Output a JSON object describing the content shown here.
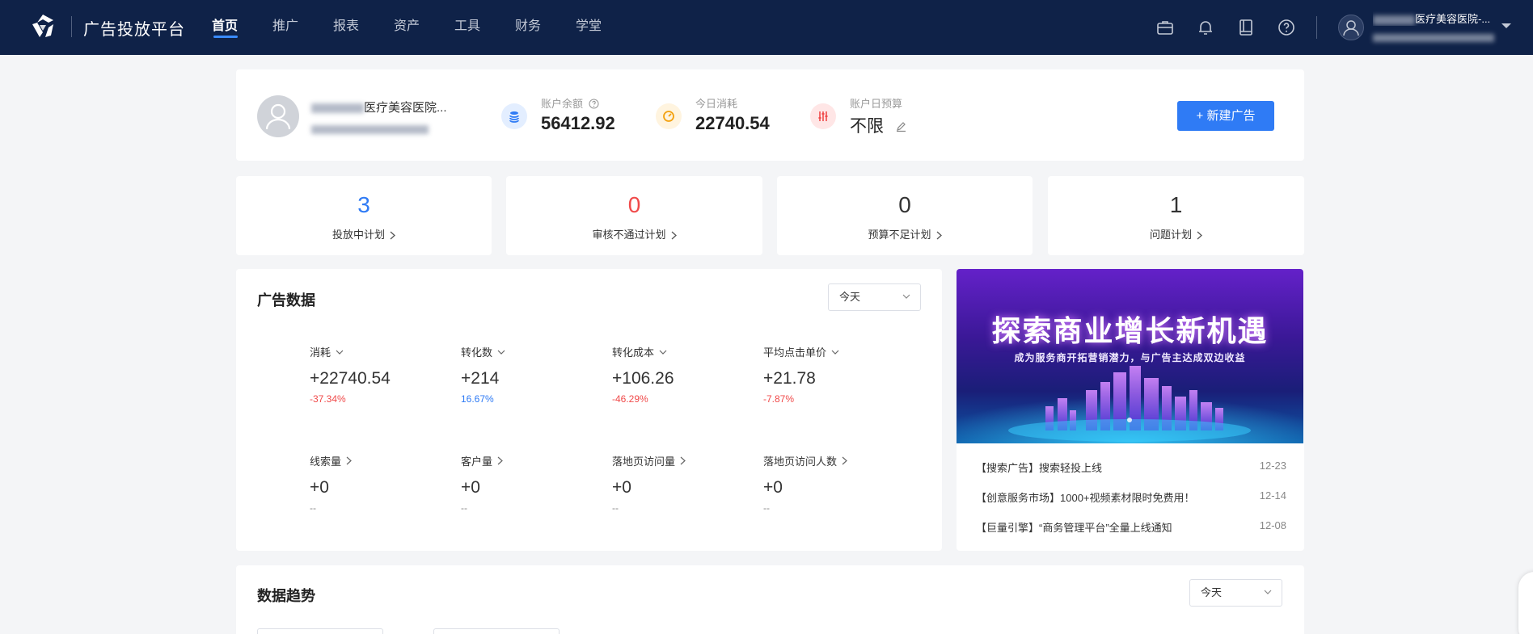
{
  "topbar": {
    "brand": "广告投放平台",
    "nav": [
      {
        "label": "首页",
        "active": true
      },
      {
        "label": "推广",
        "active": false
      },
      {
        "label": "报表",
        "active": false
      },
      {
        "label": "资产",
        "active": false
      },
      {
        "label": "工具",
        "active": false
      },
      {
        "label": "财务",
        "active": false
      },
      {
        "label": "学堂",
        "active": false
      }
    ],
    "icons": [
      "briefcase-icon",
      "bell-icon",
      "book-icon",
      "help-icon"
    ],
    "account_name": "医疗美容医院-..."
  },
  "account": {
    "name": "医疗美容医院...",
    "balance_label": "账户余额",
    "balance": "56412.92",
    "today_spend_label": "今日消耗",
    "today_spend": "22740.54",
    "daily_budget_label": "账户日预算",
    "daily_budget": "不限",
    "new_ad_button": "+ 新建广告"
  },
  "plans": [
    {
      "value": "3",
      "label": "投放中计划",
      "color": "#2f7bf5"
    },
    {
      "value": "0",
      "label": "审核不通过计划",
      "color": "#f04a4a"
    },
    {
      "value": "0",
      "label": "预算不足计划",
      "color": "#333333"
    },
    {
      "value": "1",
      "label": "问题计划",
      "color": "#333333"
    }
  ],
  "ad_data": {
    "title": "广告数据",
    "period": "今天",
    "metrics": [
      {
        "label": "消耗",
        "value": "+22740.54",
        "pct": "-37.34%",
        "tone": "red",
        "dropdown": true
      },
      {
        "label": "转化数",
        "value": "+214",
        "pct": "16.67%",
        "tone": "blue",
        "dropdown": true
      },
      {
        "label": "转化成本",
        "value": "+106.26",
        "pct": "-46.29%",
        "tone": "red",
        "dropdown": true
      },
      {
        "label": "平均点击单价",
        "value": "+21.78",
        "pct": "-7.87%",
        "tone": "red",
        "dropdown": true
      },
      {
        "label": "线索量",
        "value": "+0",
        "pct": "--",
        "tone": "gray",
        "dropdown": false
      },
      {
        "label": "客户量",
        "value": "+0",
        "pct": "--",
        "tone": "gray",
        "dropdown": false
      },
      {
        "label": "落地页访问量",
        "value": "+0",
        "pct": "--",
        "tone": "gray",
        "dropdown": false
      },
      {
        "label": "落地页访问人数",
        "value": "+0",
        "pct": "--",
        "tone": "gray",
        "dropdown": false
      }
    ]
  },
  "banner": {
    "title": "探索商业增长新机遇",
    "subtitle": "成为服务商开拓营销潜力，与广告主达成双边收益"
  },
  "news": [
    {
      "title": "【搜索广告】搜索轻投上线",
      "date": "12-23"
    },
    {
      "title": "【创意服务市场】1000+视频素材限时免费用！",
      "date": "12-14"
    },
    {
      "title": "【巨量引擎】“商务管理平台”全量上线通知",
      "date": "12-08"
    }
  ],
  "trend": {
    "title": "数据趋势",
    "period": "今天"
  }
}
